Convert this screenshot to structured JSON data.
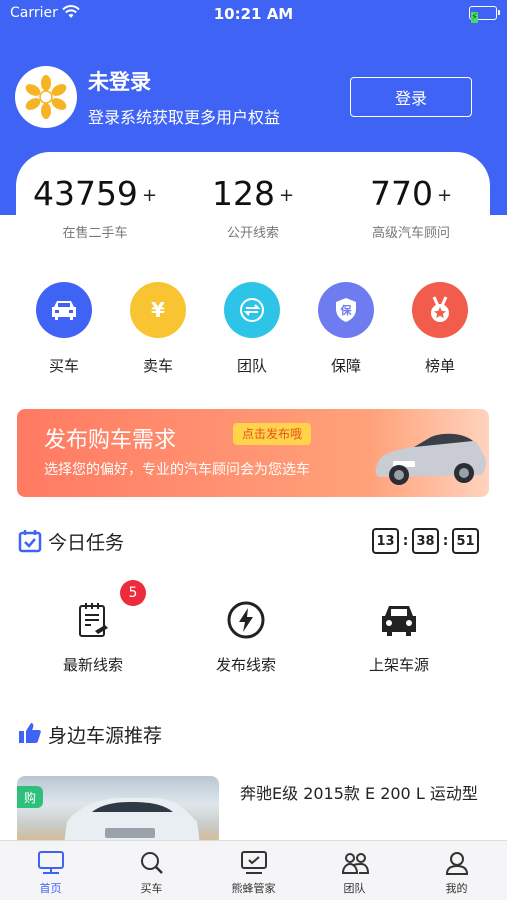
{
  "status_bar": {
    "carrier": "Carrier",
    "time": "10:21 AM",
    "battery_glyph": "⚡"
  },
  "user": {
    "name": "未登录",
    "description": "登录系统获取更多用户权益",
    "login_button": "登录"
  },
  "stats": [
    {
      "value": "43759",
      "suffix": "+",
      "label": "在售二手车"
    },
    {
      "value": "128",
      "suffix": "+",
      "label": "公开线索"
    },
    {
      "value": "770",
      "suffix": "+",
      "label": "高级汽车顾问"
    }
  ],
  "categories": [
    {
      "label": "买车",
      "icon": "car-icon",
      "color": "#3f63f4"
    },
    {
      "label": "卖车",
      "icon": "yen-icon",
      "color": "#f8c431"
    },
    {
      "label": "团队",
      "icon": "exchange-icon",
      "color": "#2ec4e8"
    },
    {
      "label": "保障",
      "icon": "shield-icon",
      "color": "#6f7cf0"
    },
    {
      "label": "榜单",
      "icon": "medal-icon",
      "color": "#f25c4c"
    }
  ],
  "banner": {
    "title": "发布购车需求",
    "tag": "点击发布哦",
    "subtitle": "选择您的偏好，专业的汽车顾问会为您选车"
  },
  "tasks_section": {
    "title": "今日任务",
    "timer": {
      "hours": "13",
      "minutes": "38",
      "seconds": "51"
    }
  },
  "tasks": [
    {
      "label": "最新线索",
      "icon": "clipboard-icon",
      "badge": "5"
    },
    {
      "label": "发布线索",
      "icon": "lightning-icon"
    },
    {
      "label": "上架车源",
      "icon": "car-front-icon"
    }
  ],
  "recommend_section": {
    "title": "身边车源推荐"
  },
  "car_listing": {
    "tag": "购",
    "title": "奔驰E级 2015款 E 200 L 运动型"
  },
  "tabbar": [
    {
      "label": "首页",
      "icon": "monitor-icon",
      "active": true
    },
    {
      "label": "买车",
      "icon": "search-icon",
      "active": false
    },
    {
      "label": "熊蜂管家",
      "icon": "screen-check-icon",
      "active": false
    },
    {
      "label": "团队",
      "icon": "team-icon",
      "active": false
    },
    {
      "label": "我的",
      "icon": "profile-icon",
      "active": false
    }
  ],
  "colors": {
    "primary": "#3f63f4",
    "badge": "#ee2b3c",
    "banner_start": "#ff7a62",
    "banner_tag": "#ffd44a"
  }
}
